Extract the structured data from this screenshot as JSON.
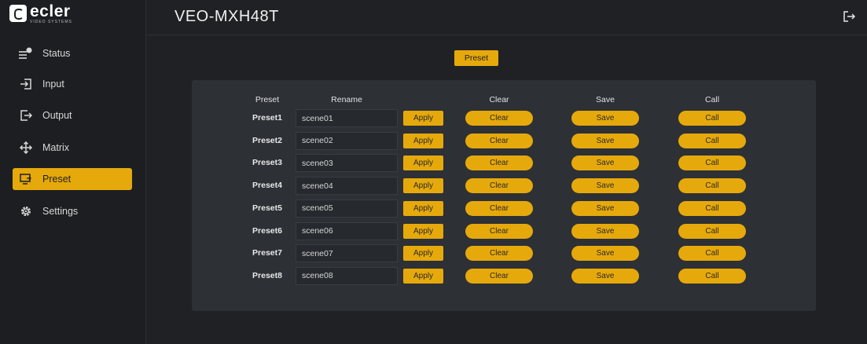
{
  "brand": {
    "name": "ecler",
    "sub": "VIDEO SYSTEMS"
  },
  "sidebar": {
    "items": [
      {
        "label": "Status",
        "icon": "status-list-icon",
        "active": false
      },
      {
        "label": "Input",
        "icon": "input-arrow-icon",
        "active": false
      },
      {
        "label": "Output",
        "icon": "output-arrow-icon",
        "active": false
      },
      {
        "label": "Matrix",
        "icon": "move-arrows-icon",
        "active": false
      },
      {
        "label": "Preset",
        "icon": "preset-monitor-icon",
        "active": true
      },
      {
        "label": "Settings",
        "icon": "gear-icon",
        "active": false
      }
    ]
  },
  "header": {
    "title": "VEO-MXH48T",
    "logout_icon": "logout-icon"
  },
  "tab": {
    "label": "Preset"
  },
  "table": {
    "headers": {
      "preset": "Preset",
      "rename": "Rename",
      "clear": "Clear",
      "save": "Save",
      "call": "Call"
    },
    "rows": [
      {
        "label": "Preset1",
        "name": "scene01",
        "apply": "Apply",
        "clear": "Clear",
        "save": "Save",
        "call": "Call"
      },
      {
        "label": "Preset2",
        "name": "scene02",
        "apply": "Apply",
        "clear": "Clear",
        "save": "Save",
        "call": "Call"
      },
      {
        "label": "Preset3",
        "name": "scene03",
        "apply": "Apply",
        "clear": "Clear",
        "save": "Save",
        "call": "Call"
      },
      {
        "label": "Preset4",
        "name": "scene04",
        "apply": "Apply",
        "clear": "Clear",
        "save": "Save",
        "call": "Call"
      },
      {
        "label": "Preset5",
        "name": "scene05",
        "apply": "Apply",
        "clear": "Clear",
        "save": "Save",
        "call": "Call"
      },
      {
        "label": "Preset6",
        "name": "scene06",
        "apply": "Apply",
        "clear": "Clear",
        "save": "Save",
        "call": "Call"
      },
      {
        "label": "Preset7",
        "name": "scene07",
        "apply": "Apply",
        "clear": "Clear",
        "save": "Save",
        "call": "Call"
      },
      {
        "label": "Preset8",
        "name": "scene08",
        "apply": "Apply",
        "clear": "Clear",
        "save": "Save",
        "call": "Call"
      }
    ]
  },
  "colors": {
    "accent": "#e6a90c",
    "background": "#1f2124",
    "panel": "#2d3035"
  }
}
